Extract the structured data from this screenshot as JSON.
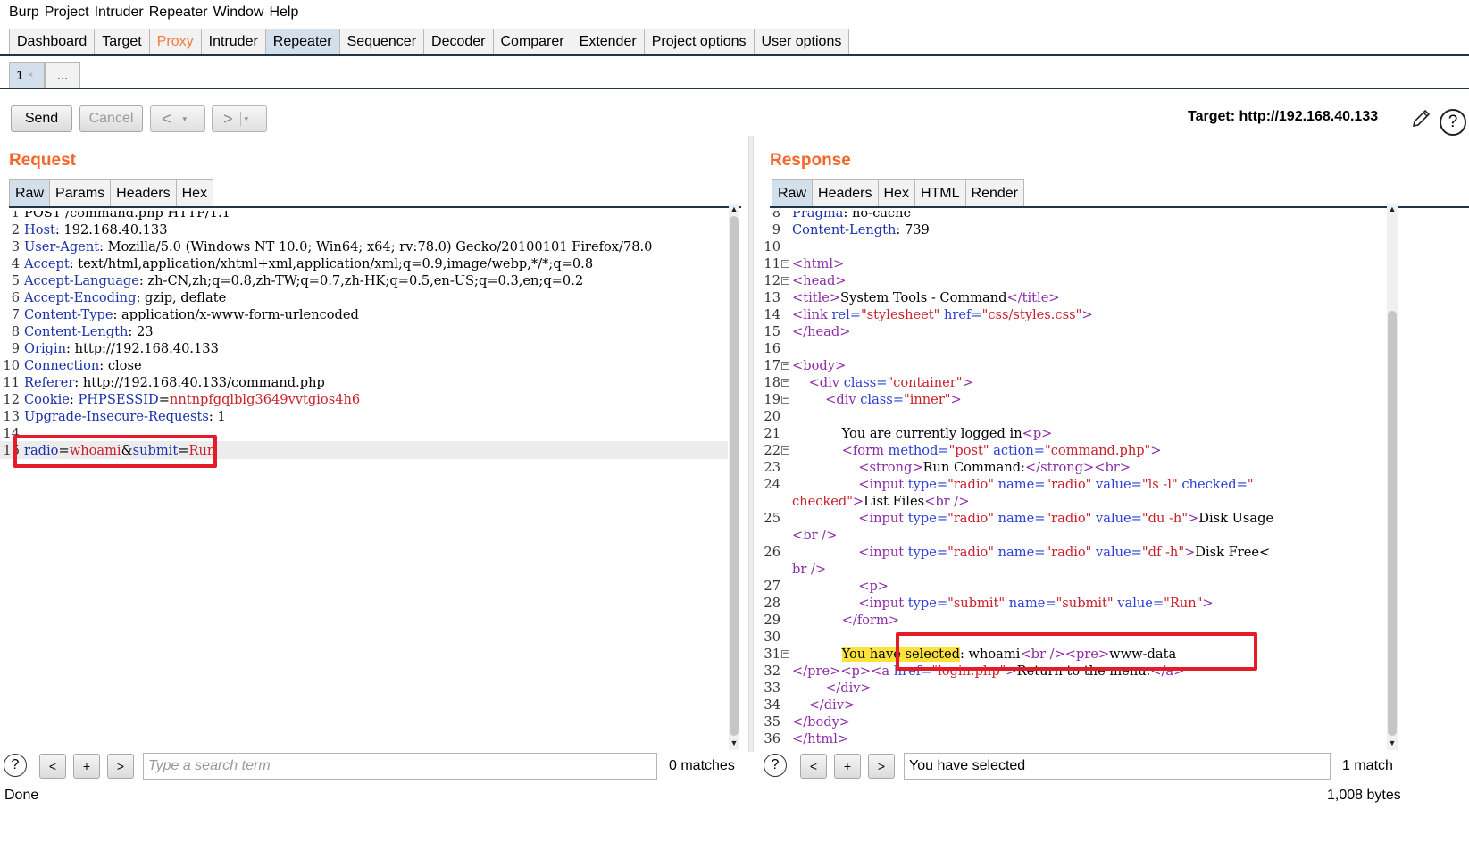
{
  "menu": [
    "Burp",
    "Project",
    "Intruder",
    "Repeater",
    "Window",
    "Help"
  ],
  "main_tabs": [
    "Dashboard",
    "Target",
    "Proxy",
    "Intruder",
    "Repeater",
    "Sequencer",
    "Decoder",
    "Comparer",
    "Extender",
    "Project options",
    "User options"
  ],
  "repeater_tabs": {
    "active": "1",
    "close": "×",
    "more": "..."
  },
  "toolbar": {
    "send": "Send",
    "cancel": "Cancel",
    "back": "<",
    "forward": ">",
    "dropdown": "▾"
  },
  "target": "Target: http://192.168.40.133",
  "help_glyph": "?",
  "request": {
    "title": "Request",
    "tabs": [
      "Raw",
      "Params",
      "Headers",
      "Hex"
    ],
    "search_placeholder": "Type a search term",
    "matches": "0 matches"
  },
  "response": {
    "title": "Response",
    "tabs": [
      "Raw",
      "Headers",
      "Hex",
      "HTML",
      "Render"
    ],
    "search_value": "You have selected",
    "matches": "1 match"
  },
  "search_buttons": {
    "prev": "<",
    "add": "+",
    "next": ">"
  },
  "status": {
    "left": "Done",
    "right": "1,008 bytes"
  },
  "colors": {
    "accent": "#f4672a",
    "tab_active": "#d3e0ec",
    "highlight_box": "#e51b2a",
    "search_hit": "#fbe33c"
  }
}
